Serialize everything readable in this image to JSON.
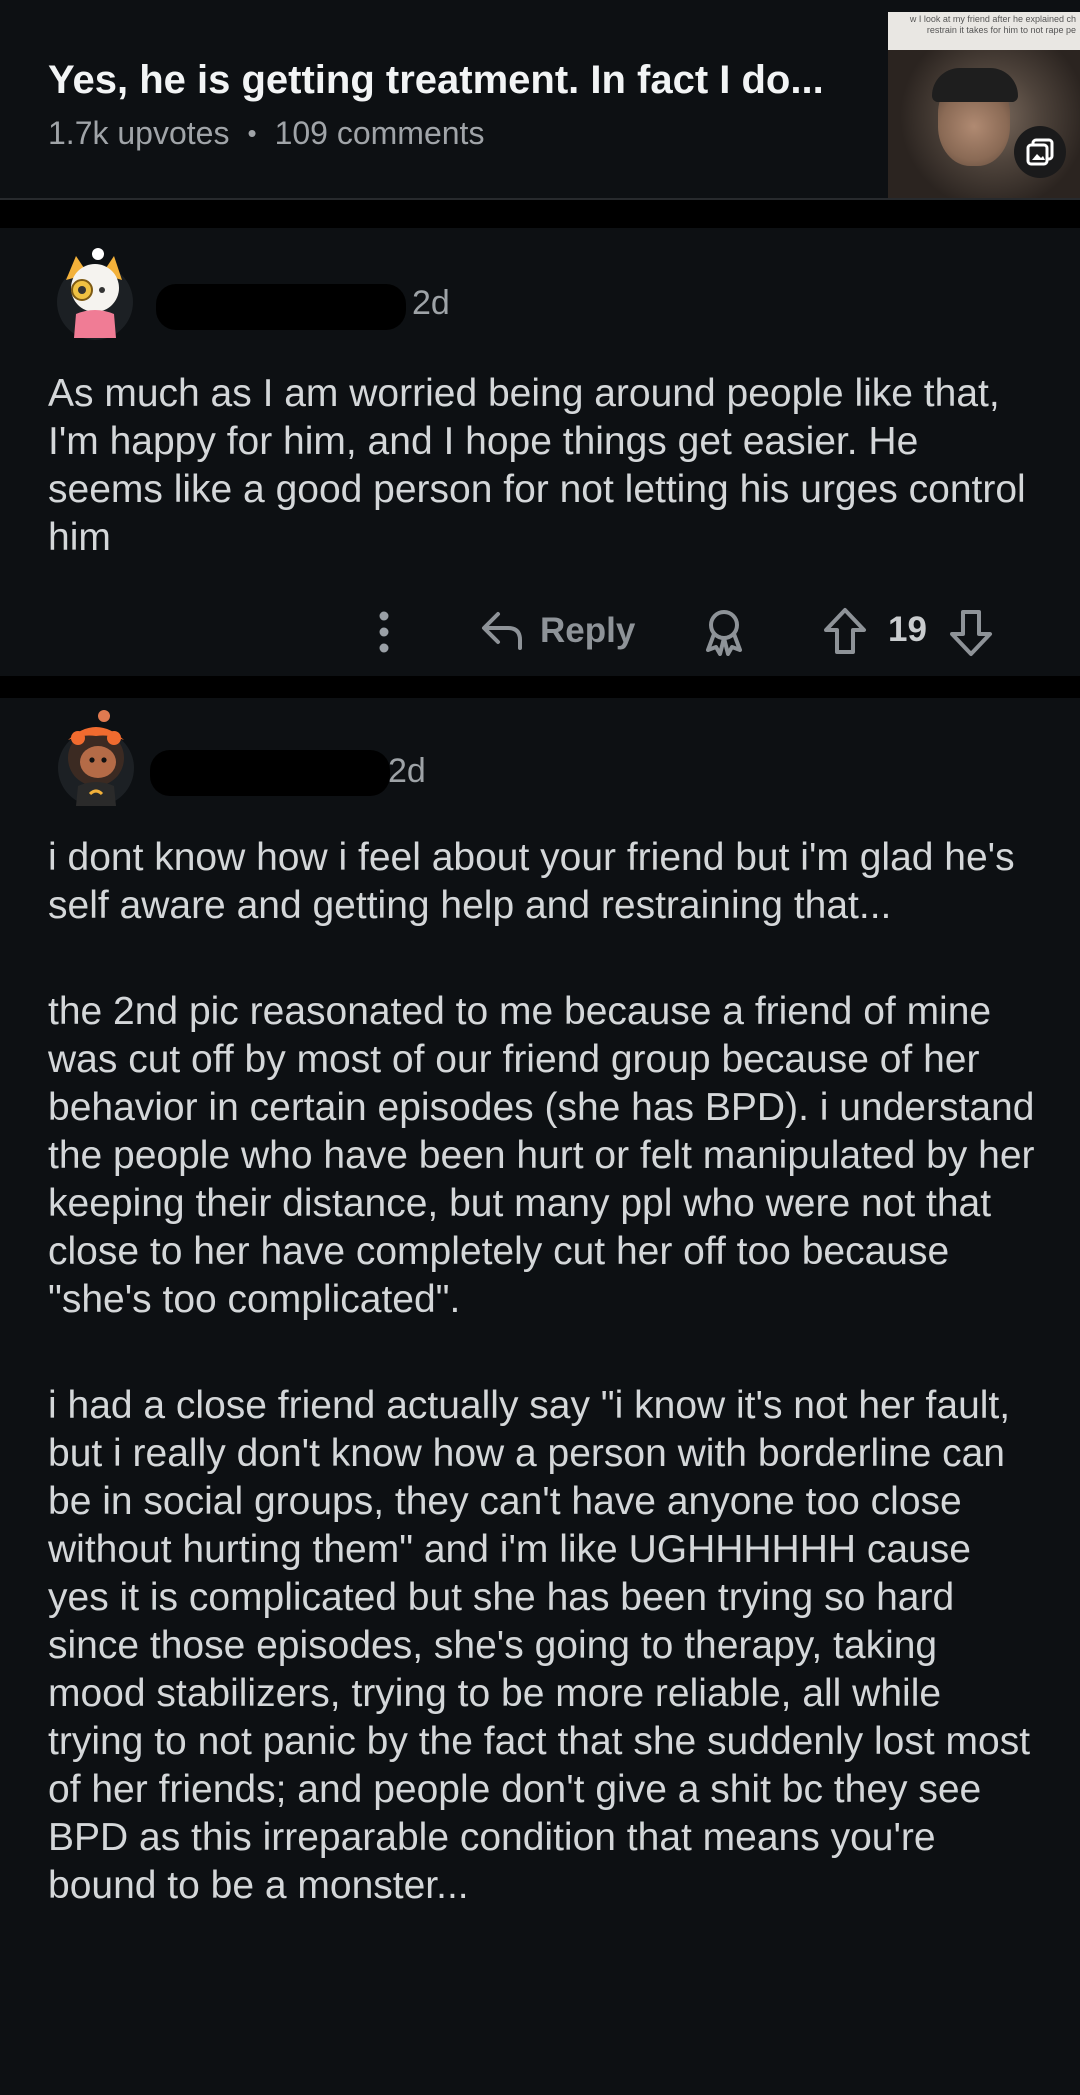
{
  "post": {
    "title": "Yes, he is getting treatment. In fact I do...",
    "upvotes": "1.7k upvotes",
    "separator": "•",
    "comments": "109 comments",
    "thumbnail_caption": "w I look at my friend after he explained ch restrain it takes for him to not rape pe"
  },
  "comments": [
    {
      "time": "2d",
      "paragraphs": [
        "As much as I am worried being around people like that, I'm happy for him, and I hope things get easier. He seems like a good person for not letting his urges control him"
      ],
      "actions": {
        "reply_label": "Reply",
        "vote_count": "19"
      }
    },
    {
      "time": "2d",
      "paragraphs": [
        "i dont know how i feel about your friend but i'm glad he's self aware and getting help and restraining that...",
        "the 2nd pic reasonated to me because a friend of mine was cut off by most of our friend group because of her behavior in certain episodes (she has BPD). i understand the people who have been hurt or felt manipulated by her keeping their distance, but many ppl who were not that close to her have completely cut her off too because \"she's too complicated\".",
        "i had a close friend actually say \"i know it's not her fault, but i really don't know how a person with borderline can be in social groups, they can't have anyone too close without hurting them\" and i'm like UGHHHHHH cause yes it is complicated but she has been trying so hard since those episodes, she's going to therapy, taking mood stabilizers, trying to be more reliable, all while trying to not panic by the fact that she suddenly lost most of her friends; and people don't give a shit bc they see BPD as this irreparable condition that means you're bound to be a monster..."
      ]
    }
  ],
  "colors": {
    "background": "#0b0d0e",
    "card": "#0d1013",
    "text": "#d4d7d9",
    "muted": "#9ea3a7",
    "separator": "#000000"
  },
  "icons": {
    "thumbnail_badge": "gallery-icon",
    "more": "more-vertical-icon",
    "reply": "reply-arrow-icon",
    "award": "award-icon",
    "upvote": "upvote-arrow-icon",
    "downvote": "downvote-arrow-icon"
  }
}
